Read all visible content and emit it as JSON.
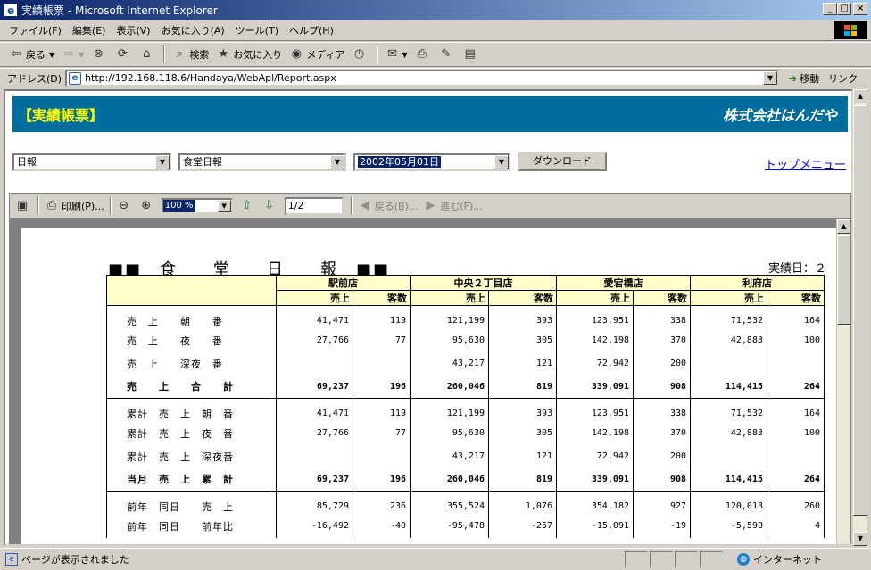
{
  "window": {
    "title": "実績帳票 - Microsoft Internet Explorer"
  },
  "menu": [
    "ファイル(F)",
    "編集(E)",
    "表示(V)",
    "お気に入り(A)",
    "ツール(T)",
    "ヘルプ(H)"
  ],
  "toolbar": {
    "back": "戻る",
    "search": "検索",
    "favorites": "お気に入り",
    "media": "メディア"
  },
  "address": {
    "label": "アドレス(D)",
    "url": "http://192.168.118.6/Handaya/WebApl/Report.aspx",
    "go": "移動",
    "links": "リンク"
  },
  "page": {
    "header_title": "【実績帳票】",
    "company": "株式会社はんだや",
    "select1": "日報",
    "select2": "食堂日報",
    "select3": "2002年05月01日",
    "download": "ダウンロード",
    "top_menu": "トップメニュー"
  },
  "viewer": {
    "print": "印刷(P)...",
    "zoom": "100 %",
    "page": "1/2",
    "back": "戻る(B)...",
    "forward": "進む(F)..."
  },
  "report": {
    "title": "■■　食　　堂　　日　　報　■■",
    "date_label": "実績日：２",
    "stores": [
      "駅前店",
      "中央２丁目店",
      "愛宕橋店",
      "利府店"
    ],
    "sub_sales": "売上",
    "sub_customers": "客数",
    "rows": [
      {
        "label": "売　上　　朝　　番",
        "vals": [
          "41,471",
          "119",
          "121,199",
          "393",
          "123,951",
          "338",
          "71,532",
          "164"
        ]
      },
      {
        "label": "売　上　　夜　　番",
        "vals": [
          "27,766",
          "77",
          "95,630",
          "305",
          "142,198",
          "370",
          "42,883",
          "100"
        ]
      },
      {
        "label": "売　上　　深夜　番",
        "vals": [
          "",
          "",
          "43,217",
          "121",
          "72,942",
          "200",
          "",
          ""
        ]
      },
      {
        "label": "売　　上　　合　　計",
        "vals": [
          "69,237",
          "196",
          "260,046",
          "819",
          "339,091",
          "908",
          "114,415",
          "264"
        ]
      },
      {
        "label": "累計　売　上　朝　番",
        "vals": [
          "41,471",
          "119",
          "121,199",
          "393",
          "123,951",
          "338",
          "71,532",
          "164"
        ]
      },
      {
        "label": "累計　売　上　夜　番",
        "vals": [
          "27,766",
          "77",
          "95,630",
          "305",
          "142,198",
          "370",
          "42,883",
          "100"
        ]
      },
      {
        "label": "累計　売　上　深夜番",
        "vals": [
          "",
          "",
          "43,217",
          "121",
          "72,942",
          "200",
          "",
          ""
        ]
      },
      {
        "label": "当月　売　上　累　計",
        "vals": [
          "69,237",
          "196",
          "260,046",
          "819",
          "339,091",
          "908",
          "114,415",
          "264"
        ]
      },
      {
        "label": "前年　同日　　売　上",
        "vals": [
          "85,729",
          "236",
          "355,524",
          "1,076",
          "354,182",
          "927",
          "120,013",
          "260"
        ]
      },
      {
        "label": "前年　同日　　前年比",
        "vals": [
          "-16,492",
          "-40",
          "-95,478",
          "-257",
          "-15,091",
          "-19",
          "-5,598",
          "4"
        ]
      }
    ]
  },
  "status": {
    "text": "ページが表示されました",
    "zone": "インターネット"
  }
}
